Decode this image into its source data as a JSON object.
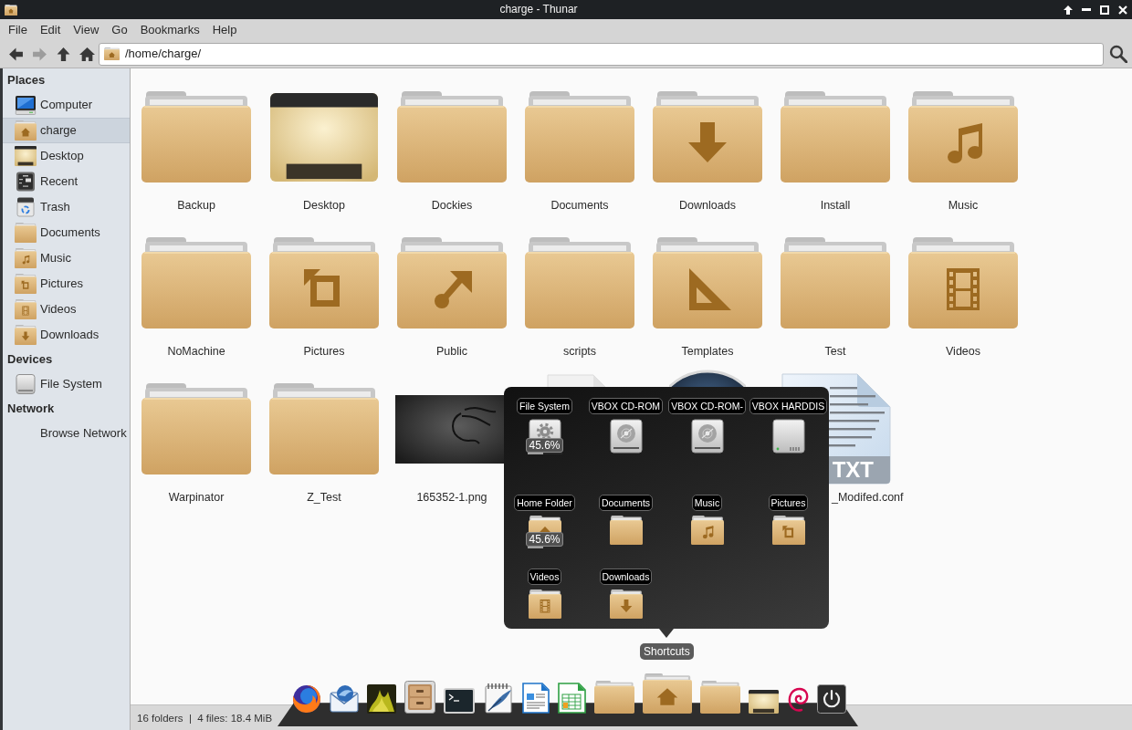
{
  "window": {
    "title": "charge - Thunar"
  },
  "menu": [
    "File",
    "Edit",
    "View",
    "Go",
    "Bookmarks",
    "Help"
  ],
  "toolbar": {
    "nav": [
      {
        "kind": "back",
        "disabled": false
      },
      {
        "kind": "forward",
        "disabled": true
      },
      {
        "kind": "up",
        "disabled": false
      },
      {
        "kind": "home",
        "disabled": false
      }
    ],
    "location": "/home/charge/"
  },
  "sidebar": {
    "sections": [
      {
        "title": "Places",
        "items": [
          {
            "label": "Computer",
            "kind": "computer",
            "selected": false
          },
          {
            "label": "charge",
            "kind": "home",
            "selected": true
          },
          {
            "label": "Desktop",
            "kind": "desktop",
            "selected": false
          },
          {
            "label": "Recent",
            "kind": "recent",
            "selected": false
          },
          {
            "label": "Trash",
            "kind": "trash",
            "selected": false
          },
          {
            "label": "Documents",
            "kind": "folder",
            "selected": false
          },
          {
            "label": "Music",
            "kind": "music",
            "selected": false
          },
          {
            "label": "Pictures",
            "kind": "pictures",
            "selected": false
          },
          {
            "label": "Videos",
            "kind": "videos",
            "selected": false
          },
          {
            "label": "Downloads",
            "kind": "downloads",
            "selected": false
          }
        ]
      },
      {
        "title": "Devices",
        "items": [
          {
            "label": "File System",
            "kind": "drive",
            "selected": false
          }
        ]
      },
      {
        "title": "Network",
        "items": [
          {
            "label": "Browse Network",
            "kind": "network",
            "selected": false
          }
        ]
      }
    ]
  },
  "files": [
    {
      "name": "Backup",
      "kind": "folder"
    },
    {
      "name": "Desktop",
      "kind": "desktop"
    },
    {
      "name": "Dockies",
      "kind": "folder"
    },
    {
      "name": "Documents",
      "kind": "folder"
    },
    {
      "name": "Downloads",
      "kind": "downloads"
    },
    {
      "name": "Install",
      "kind": "folder"
    },
    {
      "name": "Music",
      "kind": "music"
    },
    {
      "name": "NoMachine",
      "kind": "folder"
    },
    {
      "name": "Pictures",
      "kind": "pictures"
    },
    {
      "name": "Public",
      "kind": "public"
    },
    {
      "name": "scripts",
      "kind": "folder"
    },
    {
      "name": "Templates",
      "kind": "templates"
    },
    {
      "name": "Test",
      "kind": "folder"
    },
    {
      "name": "Videos",
      "kind": "videos"
    },
    {
      "name": "Warpinator",
      "kind": "folder"
    },
    {
      "name": "Z_Test",
      "kind": "folder"
    },
    {
      "name": "165352-1.png",
      "kind": "image"
    },
    {
      "kind": "document"
    },
    {
      "kind": "photo"
    },
    {
      "name": "_Modifed.conf",
      "kind": "textfile",
      "badge": "TXT"
    }
  ],
  "popup": {
    "items": [
      {
        "label": "File System",
        "kind": "system",
        "usage": {
          "text": "45.6%",
          "level": 0.456
        }
      },
      {
        "label": "VBOX CD-ROM",
        "kind": "disc"
      },
      {
        "label": "VBOX CD-ROM-",
        "kind": "disc"
      },
      {
        "label": "VBOX HARDDIS",
        "kind": "harddisk"
      },
      {
        "label": "Home Folder",
        "kind": "home",
        "usage": {
          "text": "45.6%",
          "level": 0.456
        }
      },
      {
        "label": "Documents",
        "kind": "folder"
      },
      {
        "label": "Music",
        "kind": "music"
      },
      {
        "label": "Pictures",
        "kind": "pictures"
      },
      {
        "label": "Videos",
        "kind": "videos"
      },
      {
        "label": "Downloads",
        "kind": "downloads"
      }
    ]
  },
  "dock": {
    "tooltip": "Shortcuts",
    "items": [
      {
        "kind": "browser"
      },
      {
        "kind": "mail"
      },
      {
        "kind": "viewer"
      },
      {
        "kind": "files"
      },
      {
        "kind": "terminal"
      },
      {
        "kind": "notes"
      },
      {
        "kind": "writer"
      },
      {
        "kind": "spreadsheet"
      },
      {
        "kind": "folder"
      },
      {
        "kind": "home"
      },
      {
        "kind": "folder"
      },
      {
        "kind": "desktop"
      },
      {
        "kind": "swirl"
      },
      {
        "kind": "power"
      }
    ]
  },
  "status_bar": {
    "text": "16 folders  |  4 files: 18.4 MiB"
  }
}
